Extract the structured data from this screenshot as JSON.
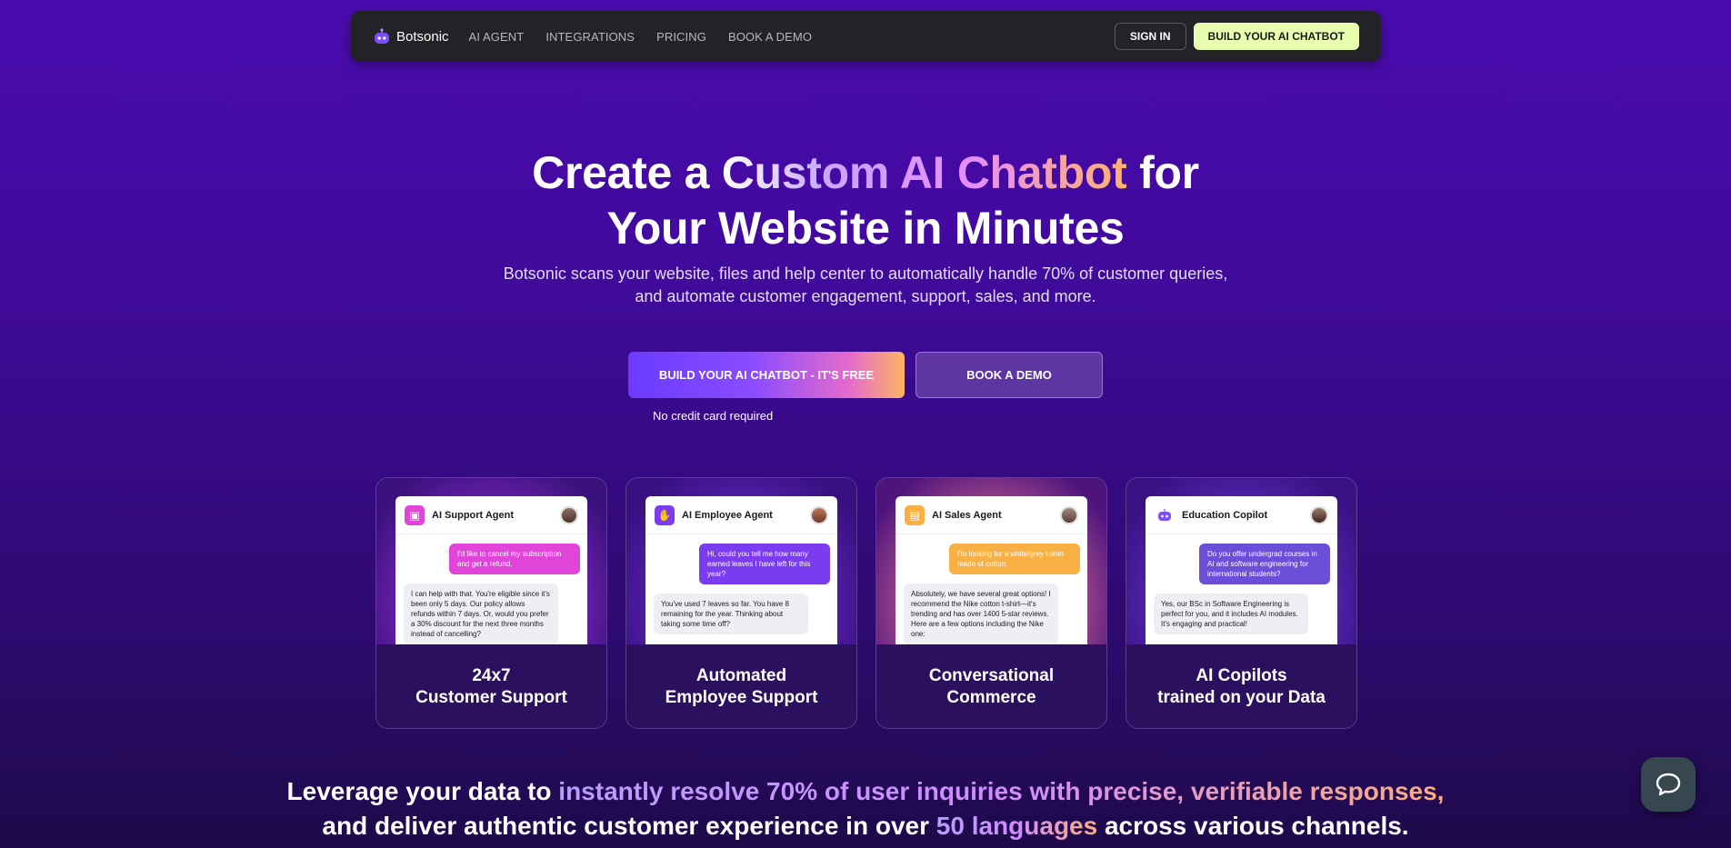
{
  "nav": {
    "brand": "Botsonic",
    "links": [
      "AI AGENT",
      "INTEGRATIONS",
      "PRICING",
      "BOOK A DEMO"
    ],
    "signin": "SIGN IN",
    "build": "BUILD YOUR AI CHATBOT"
  },
  "hero": {
    "title_part1": "Create a ",
    "title_grad": "Custom AI Chatbot",
    "title_part2": " for",
    "title_line2": "Your Website in Minutes",
    "sub_line1": "Botsonic scans your website, files and help center to automatically handle 70% of customer queries,",
    "sub_line2": "and automate customer engagement, support, sales, and more.",
    "cta_primary": "BUILD YOUR AI CHATBOT - IT'S FREE",
    "cta_secondary": "BOOK A DEMO",
    "no_credit": "No credit card required"
  },
  "cards": [
    {
      "agent": "AI Support Agent",
      "icon": "chat-bubble-icon",
      "accent": "#e044d8",
      "user_msg": "I'd like to cancel my subscription and get a refund.",
      "bot_msg": "I can help with that. You're eligible since it's been only 5 days. Our policy allows refunds within 7 days. Or, would you prefer a 30% discount for the next three months instead of cancelling?",
      "title_l1": "24x7",
      "title_l2": "Customer Support"
    },
    {
      "agent": "AI Employee Agent",
      "icon": "hand-icon",
      "accent": "#7b3cf0",
      "user_msg": "Hi, could you tell me how many earned leaves I have left for this year?",
      "bot_msg": "You've used 7 leaves so far. You have 8 remaining for the year. Thinking about taking some time off?",
      "title_l1": "Automated",
      "title_l2": "Employee Support"
    },
    {
      "agent": "AI Sales Agent",
      "icon": "shop-icon",
      "accent": "#f8b044",
      "user_msg": "I'm looking for a white/grey t-shirt made of cotton.",
      "bot_msg": "Absolutely, we have several great options! I recommend the Nike cotton t-shirt—it's trending and has over 1400 5-star reviews. Here are a few options including the Nike one:",
      "title_l1": "Conversational",
      "title_l2": "Commerce"
    },
    {
      "agent": "Education Copilot",
      "icon": "robot-icon",
      "accent": "#6b4fd8",
      "user_msg": "Do you offer undergrad courses in AI and software engineering for international students?",
      "bot_msg": "Yes, our BSc in Software Engineering is perfect for you, and it includes AI modules. It's engaging and practical!",
      "title_l1": "AI Copilots",
      "title_l2": "trained on your Data"
    }
  ],
  "leverage": {
    "l1_a": "Leverage your data to ",
    "l1_grad": "instantly resolve 70% of user inquiries with precise, verifiable responses,",
    "l2_a": "and deliver authentic customer experience in over ",
    "l2_grad": "50 languages",
    "l2_b": " across various channels."
  }
}
